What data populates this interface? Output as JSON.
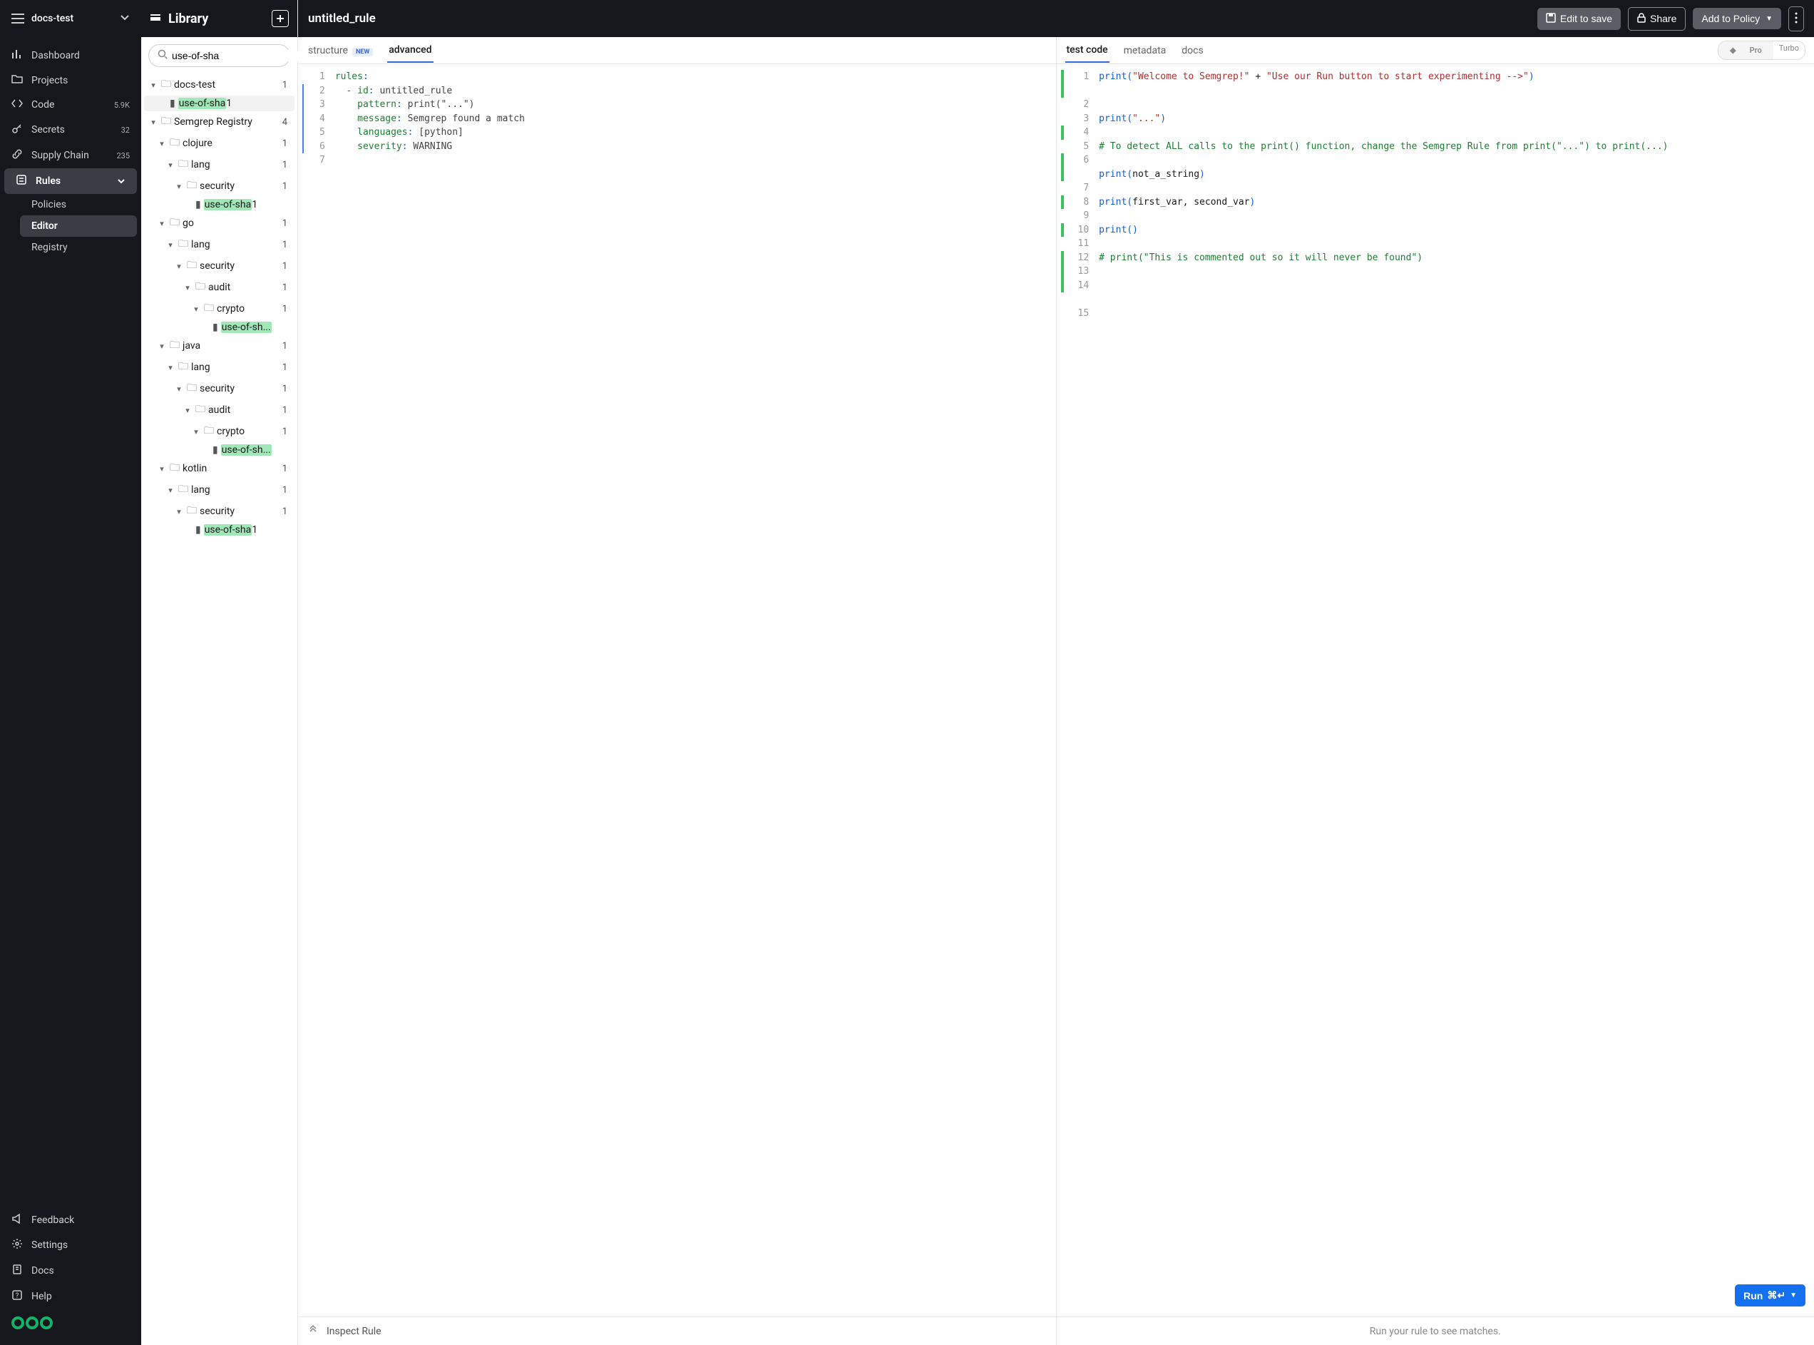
{
  "org": {
    "name": "docs-test"
  },
  "nav": {
    "dashboard": "Dashboard",
    "projects": "Projects",
    "code": "Code",
    "code_badge": "5.9K",
    "secrets": "Secrets",
    "secrets_badge": "32",
    "supply": "Supply Chain",
    "supply_badge": "235",
    "rules": "Rules",
    "policies": "Policies",
    "editor": "Editor",
    "registry": "Registry",
    "feedback": "Feedback",
    "settings": "Settings",
    "docs": "Docs",
    "help": "Help"
  },
  "library": {
    "title": "Library",
    "search_value": "use-of-sha",
    "tree": {
      "docs_test": "docs-test",
      "docs_test_count": "1",
      "rule1": "use-of-sha",
      "rule1_suffix": "1",
      "registry": "Semgrep Registry",
      "registry_count": "4",
      "clojure": "clojure",
      "clojure_cnt": "1",
      "lang": "lang",
      "lang_cnt": "1",
      "security": "security",
      "security_cnt": "1",
      "rule_clj": "use-of-sha",
      "rule_clj_suffix": "1",
      "go": "go",
      "go_cnt": "1",
      "go_lang_cnt": "1",
      "go_sec_cnt": "1",
      "audit": "audit",
      "audit_cnt": "1",
      "crypto": "crypto",
      "crypto_cnt": "1",
      "rule_go": "use-of-sh...",
      "java": "java",
      "java_cnt": "1",
      "java_lang_cnt": "1",
      "java_sec_cnt": "1",
      "java_audit_cnt": "1",
      "java_crypto_cnt": "1",
      "rule_java": "use-of-sh...",
      "kotlin": "kotlin",
      "kotlin_cnt": "1",
      "kotlin_lang_cnt": "1",
      "kotlin_sec_cnt": "1",
      "rule_kotlin": "use-of-sha",
      "rule_kotlin_suffix": "1"
    }
  },
  "header": {
    "rule_title": "untitled_rule",
    "edit_to_save": "Edit to save",
    "share": "Share",
    "add_to_policy": "Add to Policy"
  },
  "left_tabs": {
    "structure": "structure",
    "structure_badge": "NEW",
    "advanced": "advanced"
  },
  "right_tabs": {
    "test_code": "test code",
    "metadata": "metadata",
    "docs": "docs",
    "pro": "Pro",
    "turbo": "Turbo"
  },
  "inspect": {
    "label": "Inspect Rule"
  },
  "results": {
    "placeholder": "Run your rule to see matches.",
    "run_label": "Run",
    "run_shortcut": "⌘↵"
  },
  "rule_yaml": {
    "l1": {
      "k": "rules",
      "colon": ":"
    },
    "l2": {
      "dash": "- ",
      "k": "id",
      "colon": ": ",
      "v": "untitled_rule"
    },
    "l3": {
      "k": "pattern",
      "colon": ": ",
      "v": "print(\"...\")"
    },
    "l4": {
      "k": "message",
      "colon": ": ",
      "v": "Semgrep found a match"
    },
    "l5": {
      "k": "languages",
      "colon": ": ",
      "v": "[python]"
    },
    "l6": {
      "k": "severity",
      "colon": ": ",
      "v": "WARNING"
    }
  },
  "test_code": {
    "l1a": "print",
    "l1b": "(",
    "l1c": "\"Welcome to Semgrep!\"",
    "l1d": " + ",
    "l1e": "\"Use our Run button to start experimenting -->\"",
    "l1f": ")",
    "l4a": "print",
    "l4b": "(",
    "l4c": "\"...\"",
    "l4d": ")",
    "l6": "# To detect ALL calls to the print() function, change the Semgrep Rule from print(\"...\") to print(...)",
    "l8a": "print",
    "l8b": "(",
    "l8c": "not_a_string",
    "l8d": ")",
    "l10a": "print",
    "l10b": "(",
    "l10c": "first_var, second_var",
    "l10d": ")",
    "l12a": "print",
    "l12b": "(",
    "l12d": ")",
    "l14": "# print(\"This is commented out so it will never be found\")"
  }
}
